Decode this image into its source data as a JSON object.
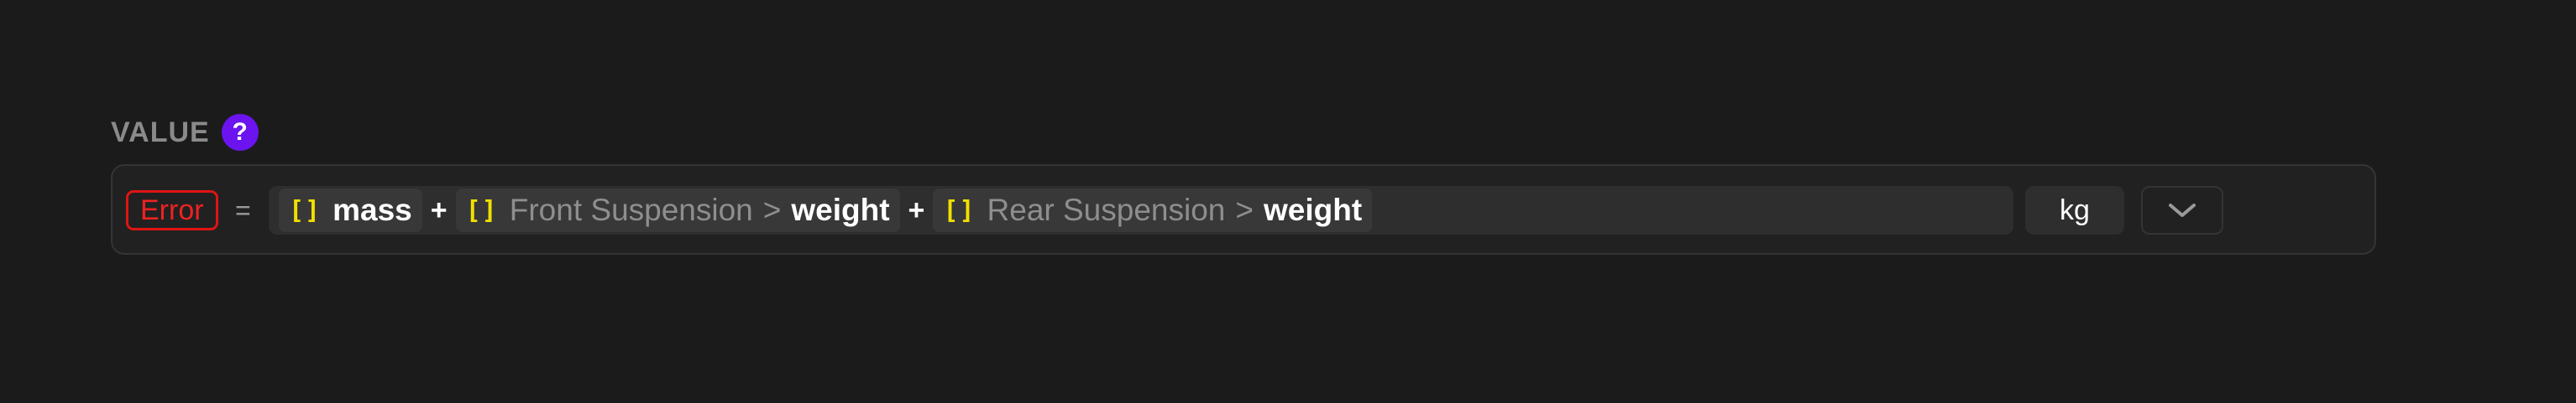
{
  "field": {
    "label": "VALUE",
    "help_icon_glyph": "?"
  },
  "status": {
    "badge": "Error",
    "color": "#e01414"
  },
  "expression": {
    "equals": "=",
    "operator": "+",
    "terms": [
      {
        "icon": "brackets-icon",
        "bracket": "[]",
        "path": "",
        "separator": "",
        "name": "mass"
      },
      {
        "icon": "brackets-icon",
        "bracket": "[]",
        "path": "Front Suspension",
        "separator": ">",
        "name": "weight"
      },
      {
        "icon": "brackets-icon",
        "bracket": "[]",
        "path": "Rear Suspension",
        "separator": ">",
        "name": "weight"
      }
    ]
  },
  "unit": {
    "value": "kg",
    "dropdown_icon": "chevron-down-icon"
  },
  "colors": {
    "background": "#1b1b1b",
    "accent": "#6b14f0",
    "reference_bracket": "#f0e000"
  }
}
